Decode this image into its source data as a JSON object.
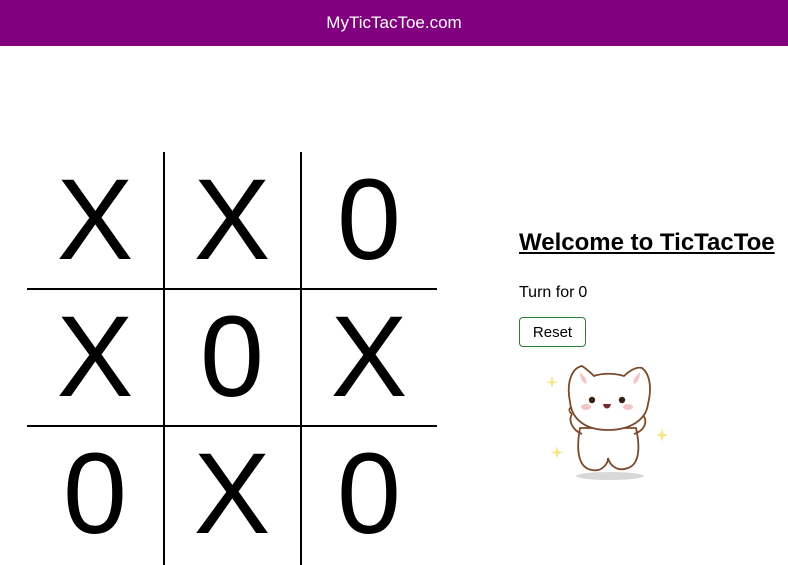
{
  "navbar": {
    "title": "MyTicTacToe.com",
    "bg_color": "#800080"
  },
  "board": {
    "cells": [
      "X",
      "X",
      "0",
      "X",
      "0",
      "X",
      "0",
      "X",
      "0"
    ]
  },
  "panel": {
    "heading": "Welcome to TicTacToe",
    "turn_label": "Turn for",
    "turn_value": "0",
    "reset_label": "Reset",
    "reset_border_color": "#2e7d32"
  },
  "illustration": {
    "icon": "cat-sticker-icon"
  }
}
